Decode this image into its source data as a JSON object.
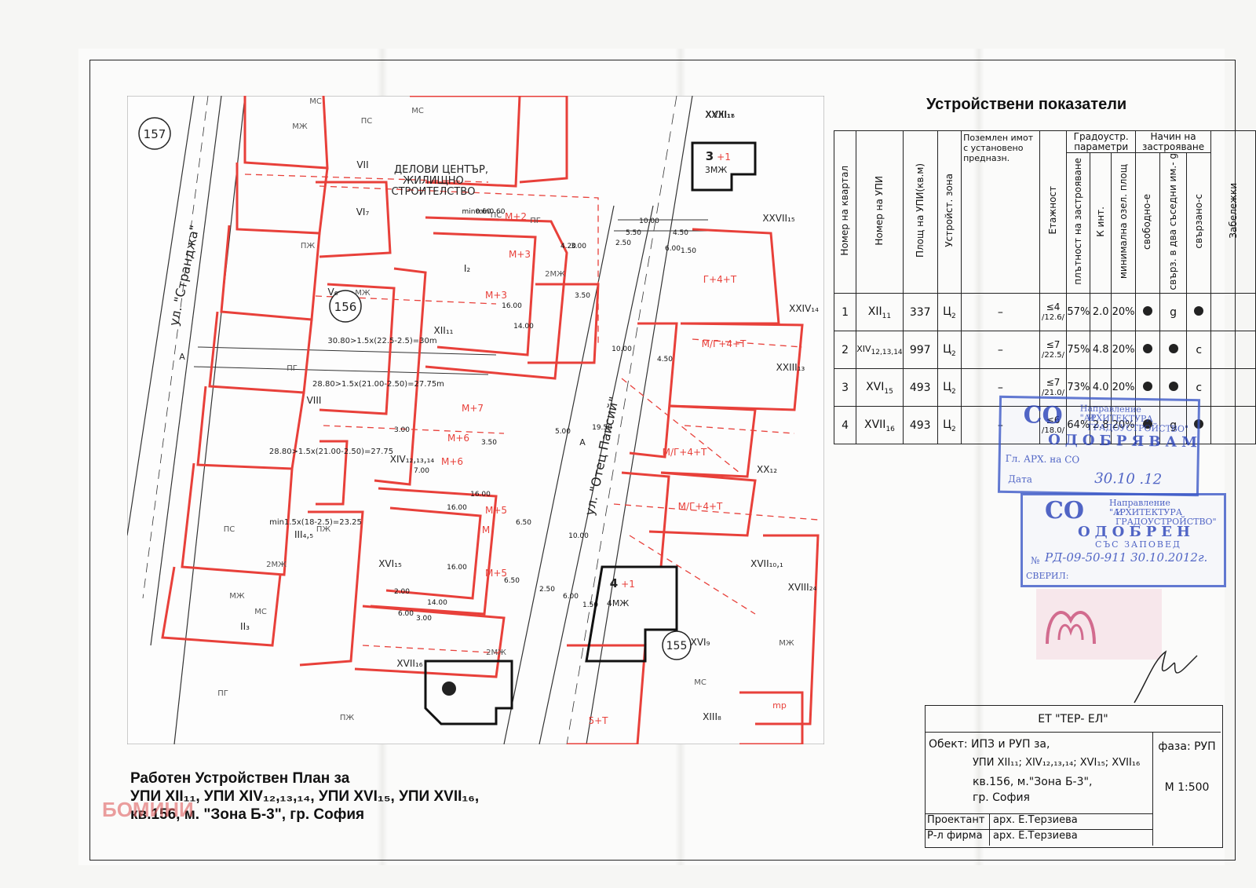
{
  "indicators": {
    "title": "Устройствени показатели",
    "group_headers": {
      "grado": "Градоустр. параметри",
      "nachin": "Начин на застрояване"
    },
    "headers": [
      "Номер на квартал",
      "Номер на УПИ",
      "Площ на УПИ(кв.м)",
      "Устройст. зона",
      "Поземлен имот с установено предназн.",
      "Етажност",
      "плътност на застрояване",
      "К инт.",
      "минимална озел. площ",
      "свободно-е",
      "свърз. в два съседни им.- g",
      "свързано-с",
      "Забележки"
    ],
    "rows": [
      {
        "n": "1",
        "upi": "XII",
        "upi_sub": "11",
        "area": "337",
        "zone": "Ц",
        "zone_sub": "2",
        "imot": "–",
        "floors": "≤4",
        "height": "/12.6/",
        "dens": "57%",
        "kint": "2.0",
        "green": "20%",
        "c1": "dot",
        "c2": "g",
        "c3": "dot"
      },
      {
        "n": "2",
        "upi": "XIV",
        "upi_sub": "12,13,14",
        "area": "997",
        "zone": "Ц",
        "zone_sub": "2",
        "imot": "–",
        "floors": "≤7",
        "height": "/22.5/",
        "dens": "75%",
        "kint": "4.8",
        "green": "20%",
        "c1": "dot",
        "c2": "dot",
        "c3": "c"
      },
      {
        "n": "3",
        "upi": "XVI",
        "upi_sub": "15",
        "area": "493",
        "zone": "Ц",
        "zone_sub": "2",
        "imot": "–",
        "floors": "≤7",
        "height": "/21.0/",
        "dens": "73%",
        "kint": "4.0",
        "green": "20%",
        "c1": "dot",
        "c2": "dot",
        "c3": "c"
      },
      {
        "n": "4",
        "upi": "XVII",
        "upi_sub": "16",
        "area": "493",
        "zone": "Ц",
        "zone_sub": "2",
        "imot": "–",
        "floors": "≤6",
        "height": "/18.0/",
        "dens": "64%",
        "kint": "2.8",
        "green": "20%",
        "c1": "dot",
        "c2": "g",
        "c3": "dot"
      }
    ]
  },
  "stamps": {
    "s1": {
      "co": "СО",
      "line1": "Направление \"АРХИТЕКТУРА",
      "line2": "И ГРАДОУСТРОЙСТВО\"",
      "big": "ОДОБРЯВАМ",
      "l3": "Гл. АРХ. на СО",
      "l4": "Дата",
      "hand": "30.10 .12"
    },
    "s2": {
      "co": "СО",
      "line1": "Направление \"АРХИТЕКТУРА",
      "line2": "И ГРАДОУСТРОЙСТВО\"",
      "big": "ОДОБРЕН",
      "sub": "СЪС ЗАПОВЕД",
      "l3": "№",
      "hand": "РД-09-50-911 30.10.2012г.",
      "l4": "СВЕРИЛ:"
    }
  },
  "title_block": {
    "firm": "ЕТ \"ТЕР- ЕЛ\"",
    "object_line1": "Обект: ИПЗ и РУП за,",
    "object_line2": "УПИ XII₁₁; XIV₁₂,₁₃,₁₄; XVI₁₅; XVII₁₆",
    "object_line3": "кв.156, м.\"Зона Б-3\",",
    "object_line4": "гр. София",
    "phase": "фаза: РУП",
    "scale": "М 1:500",
    "designer_label": "Проектант",
    "designer_name": "арх. Е.Терзиева",
    "firm_label": "Р-л фирма",
    "firm_name": "арх. Е.Терзиева"
  },
  "caption": {
    "line1": "Работен Устройствен План за",
    "line2": "УПИ XII₁₁, УПИ XIV₁₂,₁₃,₁₄, УПИ XVI₁₅, УПИ XVII₁₆,",
    "line3": "кв.156, м. \"Зона Б-3\",  гр. София"
  },
  "watermark": "БОМИНИ",
  "map": {
    "quarter_157": "157",
    "quarter_156": "156",
    "quarter_155": "155",
    "street_left": "ул. \"Странджа\"",
    "street_right": "ул. \"Отец Паисий\"",
    "business_text": [
      "ДЕЛОВИ ЦЕНТЪР,",
      "ЖИЛИЩНО",
      "СТРОИТЕЛСТВО"
    ],
    "box3": {
      "num": "3",
      "plus": "+1",
      "label": "3МЖ"
    },
    "box4": {
      "num": "4",
      "plus": "+1",
      "label": "4МЖ"
    },
    "formulas": [
      "30.80>1.5x(22.5-2.5)=30m",
      "28.80>1.5x(21.00-2.50)=27.75m",
      "28.80>1.5x(21.00-2.50)=27.75",
      "min1.5x(18-2.5)=23.25"
    ],
    "plot_labels": [
      {
        "t": "XXXI₁₆"
      },
      {
        "t": "XXVII₁₅"
      },
      {
        "t": "XXIV₁₄"
      },
      {
        "t": "XXIII₁₃"
      },
      {
        "t": "XX₁₂"
      },
      {
        "t": "XVII₁₀,₁"
      },
      {
        "t": "XVIII₂₄"
      },
      {
        "t": "XVI₉"
      },
      {
        "t": "XIII₈"
      },
      {
        "t": "V₆"
      },
      {
        "t": "VI₇"
      },
      {
        "t": "VII"
      },
      {
        "t": "VIII"
      },
      {
        "t": "III₄,₅"
      },
      {
        "t": "II₃"
      },
      {
        "t": "I₂"
      },
      {
        "t": "XII₁₁"
      },
      {
        "t": "XIV₁₂,₁₃,₁₄"
      },
      {
        "t": "XVI₁₅"
      },
      {
        "t": "XVII₁₆"
      },
      {
        "t": "XVIII₁₇"
      }
    ],
    "height_labels": [
      "М+2",
      "М+3",
      "М+3",
      "М+7",
      "М+6",
      "М+6",
      "М+5",
      "М+5",
      "М",
      "Г+4+Т",
      "М/Г+4+Т",
      "М/Г+4+Т",
      "М/Г+4+Т",
      "5+Т"
    ],
    "dimensions": [
      "10.00",
      "5.50",
      "4.50",
      "2.50",
      "6.00",
      "1.50",
      "16.00",
      "14.00",
      "3.50",
      "10.00",
      "4.50",
      "19.50",
      "5.00",
      "16.00",
      "16.00",
      "6.50",
      "10.00",
      "16.00",
      "6.50",
      "14.00",
      "6.00",
      "2.50",
      "1.50",
      "2.00",
      "6.00",
      "3.00",
      "3.00",
      "7.00",
      "3.50",
      "4.20",
      "3.00",
      "min0.60",
      "min0.60"
    ],
    "symbols": [
      "МС",
      "МЖ",
      "ПС",
      "ПГ",
      "ПЖ",
      "2МЖ",
      "mp"
    ],
    "section_mark": "А"
  },
  "colors": {
    "plan_red": "#e8403a",
    "stamp_blue": "#3c59c8",
    "ink": "#222222"
  }
}
